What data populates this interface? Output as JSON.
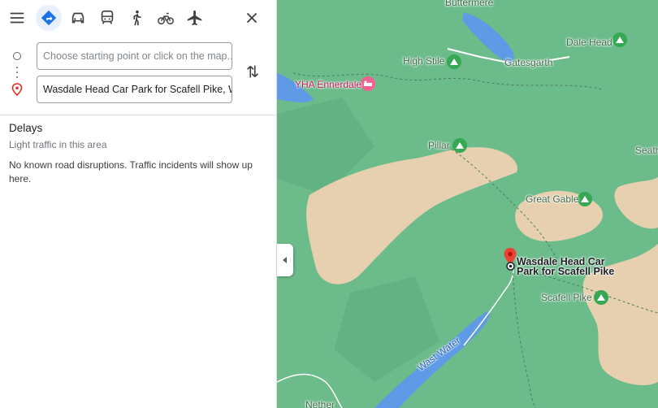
{
  "travel_modes": [
    {
      "name": "best",
      "icon": "directions-icon",
      "active": true
    },
    {
      "name": "driving",
      "icon": "car-icon",
      "active": false
    },
    {
      "name": "transit",
      "icon": "train-icon",
      "active": false
    },
    {
      "name": "walking",
      "icon": "walk-icon",
      "active": false
    },
    {
      "name": "cycling",
      "icon": "bike-icon",
      "active": false
    },
    {
      "name": "flights",
      "icon": "plane-icon",
      "active": false
    }
  ],
  "directions": {
    "origin_placeholder": "Choose starting point or click on the map...",
    "destination_value": "Wasdale Head Car Park for Scafell Pike, W"
  },
  "delays": {
    "title": "Delays",
    "subtitle": "Light traffic in this area",
    "text": "No known road disruptions. Traffic incidents will show up here."
  },
  "map": {
    "labels": {
      "buttermere": "Buttermere",
      "gatesgarth": "Gatesgarth",
      "dale_head": "Dale Head",
      "high_stile": "High Stile",
      "yha": "YHA Ennerdale",
      "pillar": "Pillar",
      "seathwaite": "Seath",
      "great_gable": "Great Gable",
      "scafell_pike": "Scafell Pike",
      "wast_water": "Wast Water",
      "nether": "Nether",
      "destination": "Wasdale Head Car Park for Scafell Pike"
    },
    "colors": {
      "land": "#6cbb8b",
      "fell": "#e7d0b0",
      "water": "#5e9ae6",
      "pin": "#ea4335",
      "peak": "#34a853"
    }
  }
}
